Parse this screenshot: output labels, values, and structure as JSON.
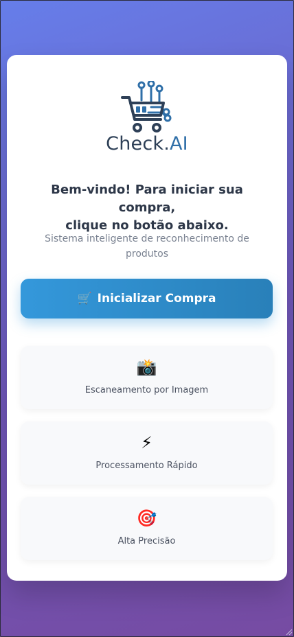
{
  "brand": {
    "name_main": "Check.",
    "name_accent": "AI"
  },
  "welcome": {
    "line1": "Bem-vindo! Para iniciar sua compra,",
    "line2": "clique no botão abaixo."
  },
  "subtitle": "Sistema inteligente de reconhecimento de produtos",
  "start_button": {
    "icon": "🛒",
    "label": "Inicializar Compra"
  },
  "features": [
    {
      "icon": "📸",
      "icon_name": "camera-flash-icon",
      "label": "Escaneamento por Imagem"
    },
    {
      "icon": "⚡",
      "icon_name": "lightning-icon",
      "label": "Processamento Rápido"
    },
    {
      "icon": "🎯",
      "icon_name": "target-icon",
      "label": "Alta Precisão"
    }
  ],
  "colors": {
    "background_start": "#667eea",
    "background_end": "#764ba2",
    "button_start": "#3498db",
    "button_end": "#2980b9",
    "brand_dark": "#2e4057",
    "brand_accent": "#2f6fa8"
  }
}
